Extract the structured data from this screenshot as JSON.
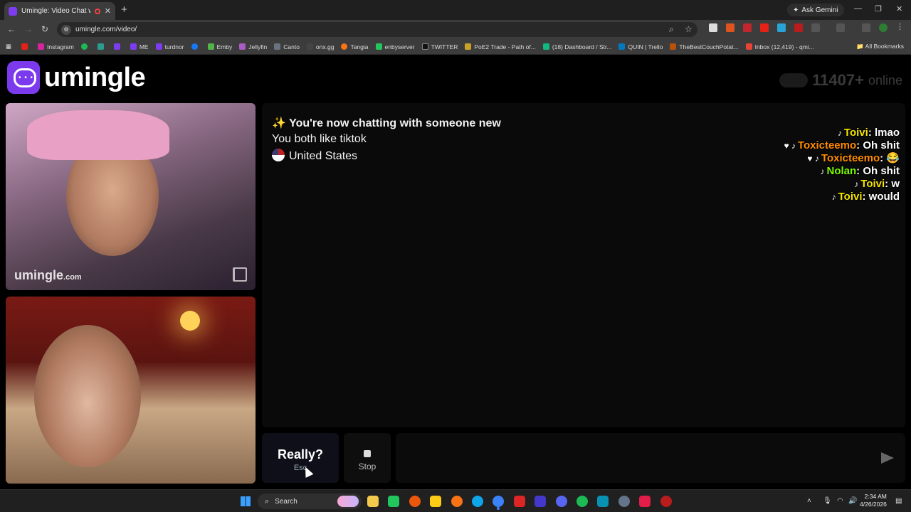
{
  "browser": {
    "tab_title": "Umingle: Video Chat with S",
    "new_tab": "+",
    "ask_gemini": "Ask Gemini",
    "url": "umingle.com/video/",
    "bookmarks": [
      {
        "label": "",
        "color": "#e62117"
      },
      {
        "label": "Instagram",
        "color": "#d6249f"
      },
      {
        "label": "",
        "color": "#1db954"
      },
      {
        "label": "",
        "color": "#2a9d8f"
      },
      {
        "label": "",
        "color": "#7e3cf0"
      },
      {
        "label": "ME",
        "color": "#7e3cf0"
      },
      {
        "label": "turdnor",
        "color": "#7e3cf0"
      },
      {
        "label": "",
        "color": "#1877f2"
      },
      {
        "label": "Emby",
        "color": "#52b54b"
      },
      {
        "label": "Jellyfin",
        "color": "#aa5cc3"
      },
      {
        "label": "Canto",
        "color": "#6b7280"
      },
      {
        "label": "onx.gg",
        "color": "#444444"
      },
      {
        "label": "Tangia",
        "color": "#f97316"
      },
      {
        "label": "enbyserver",
        "color": "#22c55e"
      },
      {
        "label": "TWITTER",
        "color": "#000000"
      },
      {
        "label": "PoE2 Trade - Path of...",
        "color": "#c9a227"
      },
      {
        "label": "(18) Dashboard / Str...",
        "color": "#10b981"
      },
      {
        "label": "QUIN | Trello",
        "color": "#0079bf"
      },
      {
        "label": "TheBestCouchPotat...",
        "color": "#b45309"
      },
      {
        "label": "Inbox (12,419) - qmi...",
        "color": "#ea4335"
      }
    ],
    "all_bookmarks": "All Bookmarks"
  },
  "site": {
    "logo_text": "umingle",
    "online_count": "11407+",
    "online_label": "online",
    "watermark_main": "umingle",
    "watermark_suffix": ".com"
  },
  "chat": {
    "headline_emoji": "✨",
    "headline": "You're now chatting with someone new",
    "common_interest": "You both like tiktok",
    "country": "United States"
  },
  "overlay_messages": [
    {
      "prefix": "♪",
      "name": "Toivi",
      "name_color": "#f5e400",
      "text": "lmao"
    },
    {
      "prefix": "♥ ♪",
      "name": "Toxicteemo",
      "name_color": "#ff8c00",
      "text": "Oh shit"
    },
    {
      "prefix": "♥ ♪",
      "name": "Toxicteemo",
      "name_color": "#ff8c00",
      "text": "😂"
    },
    {
      "prefix": "♪",
      "name": "Nolan",
      "name_color": "#7cfc00",
      "text": "Oh shit"
    },
    {
      "prefix": "♪",
      "name": "Toivi",
      "name_color": "#f5e400",
      "text": "w"
    },
    {
      "prefix": "♪",
      "name": "Toivi",
      "name_color": "#f5e400",
      "text": "would"
    }
  ],
  "controls": {
    "skip_label": "Really?",
    "skip_hint": "Esc",
    "stop_label": "Stop",
    "message_placeholder": ""
  },
  "taskbar": {
    "search_label": "Search",
    "time": "2:34 AM",
    "date": "4/26/2026"
  }
}
